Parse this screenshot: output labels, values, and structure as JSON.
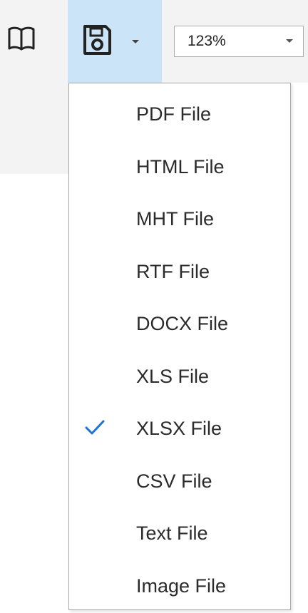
{
  "toolbar": {
    "book_icon": "book-icon",
    "save_icon": "save-icon",
    "dropdown_icon": "chevron-down-icon",
    "zoom": {
      "value": "123%"
    }
  },
  "save_menu": {
    "items": [
      {
        "label": "PDF File",
        "checked": false
      },
      {
        "label": "HTML File",
        "checked": false
      },
      {
        "label": "MHT File",
        "checked": false
      },
      {
        "label": "RTF File",
        "checked": false
      },
      {
        "label": "DOCX File",
        "checked": false
      },
      {
        "label": "XLS File",
        "checked": false
      },
      {
        "label": "XLSX File",
        "checked": true
      },
      {
        "label": "CSV File",
        "checked": false
      },
      {
        "label": "Text File",
        "checked": false
      },
      {
        "label": "Image File",
        "checked": false
      }
    ]
  },
  "colors": {
    "toolbar_bg": "#f3f3f3",
    "active_button_bg": "#cce4f7",
    "checkmark": "#1e73d8",
    "menu_text": "#2b2b2b"
  }
}
